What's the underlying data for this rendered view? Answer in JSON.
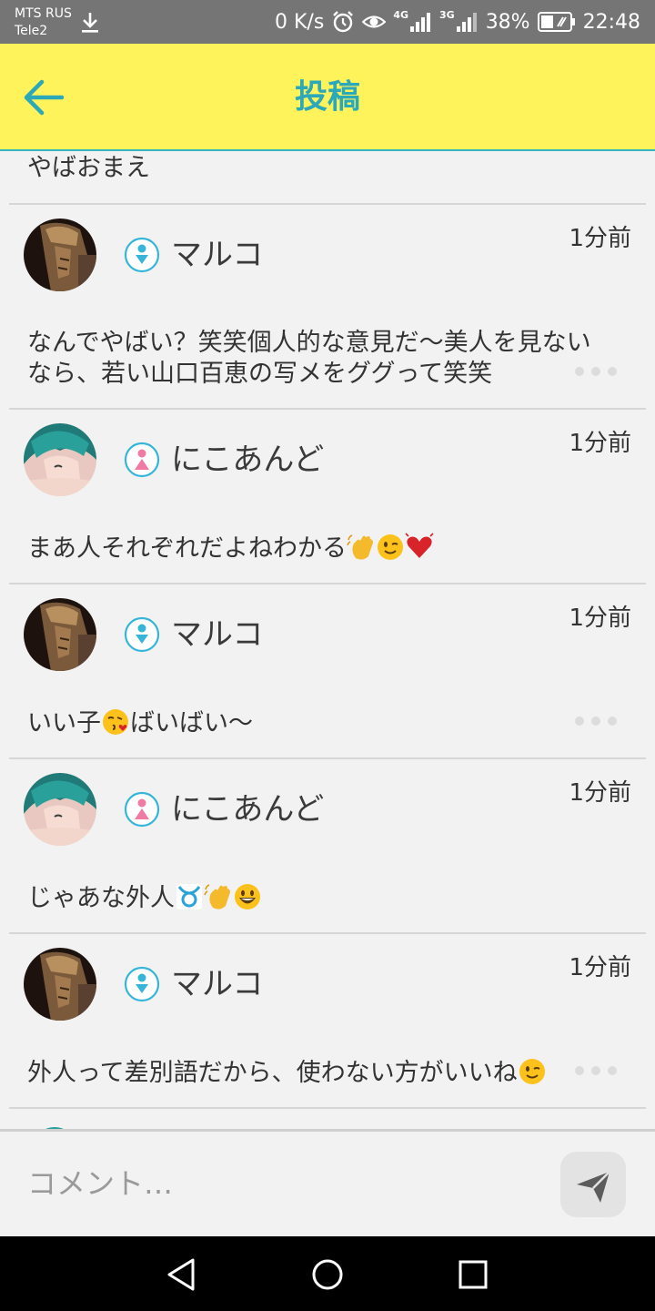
{
  "status_bar": {
    "carrier_1": "MTS RUS",
    "carrier_2": "Tele2",
    "net_speed": "0 K/s",
    "signal_1": "4G",
    "signal_2": "3G",
    "battery": "38%",
    "time": "22:48",
    "icons": [
      "download-icon",
      "alarm-icon",
      "eye-icon",
      "signal-icon",
      "battery-icon"
    ]
  },
  "app_bar": {
    "title": "投稿",
    "back_icon": "arrow-left-icon",
    "background": "#fff35c",
    "accent": "#2ca9b8"
  },
  "feed": {
    "previous_tail": "やばおまえ",
    "comments": [
      {
        "user": "マルコ",
        "gender": "male",
        "time": "1分前",
        "lines": [
          "なんでやばい？笑笑個人的な意見だ〜美人を見ない",
          "なら、若い山口百恵の写メをググって笑笑"
        ],
        "emojis": [],
        "has_more": true
      },
      {
        "user": "にこあんど",
        "gender": "female",
        "time": "1分前",
        "text": "まあ人それぞれだよねわかる",
        "emojis": [
          "waving-hand-emoji",
          "winking-face-emoji",
          "beating-heart-emoji"
        ],
        "has_more": false
      },
      {
        "user": "マルコ",
        "gender": "male",
        "time": "1分前",
        "text_before": "いい子",
        "emoji_mid": "face-blowing-kiss-emoji",
        "text_after": "ばいばい〜",
        "has_more": true
      },
      {
        "user": "にこあんど",
        "gender": "female",
        "time": "1分前",
        "text": "じゃあな外人",
        "emojis": [
          "taurus-emoji",
          "waving-hand-emoji",
          "grinning-face-emoji"
        ],
        "has_more": false
      },
      {
        "user": "マルコ",
        "gender": "male",
        "time": "1分前",
        "text": "外人って差別語だから、使わない方がいいね",
        "emojis": [
          "winking-face-emoji"
        ],
        "has_more": true
      }
    ],
    "colors": {
      "male": "#35b6d9",
      "female": "#f07aa0"
    }
  },
  "input_bar": {
    "placeholder": "コメント…",
    "send_icon": "send-icon"
  },
  "nav_bar": {
    "icons": [
      "back-triangle-icon",
      "home-circle-icon",
      "recents-square-icon"
    ]
  }
}
